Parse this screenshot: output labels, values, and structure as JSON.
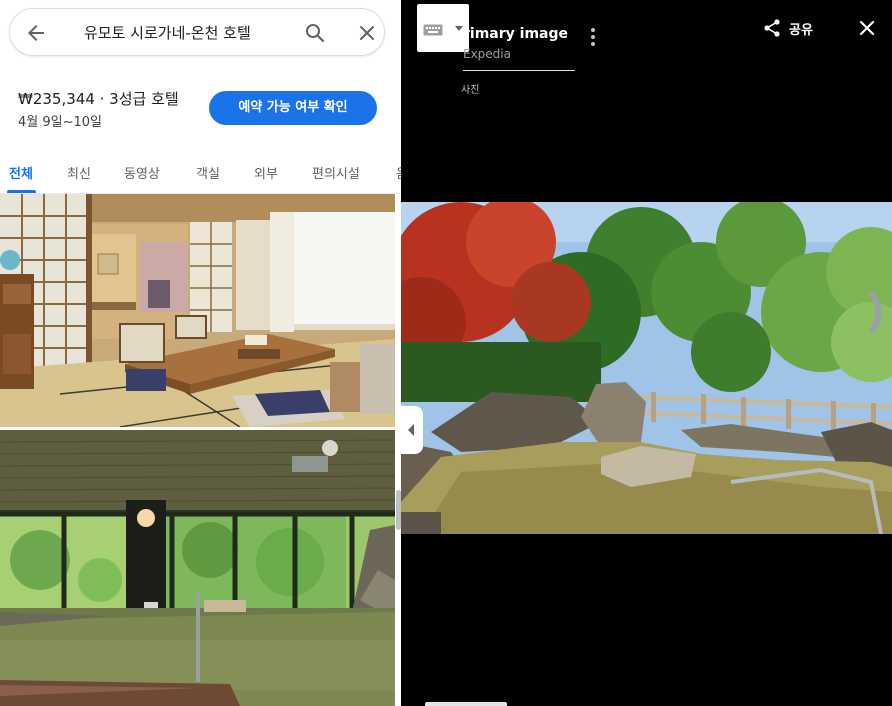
{
  "search": {
    "query": "유모토 시로가네-온천 호텔"
  },
  "hotel": {
    "price_line": "₩235,344 · 3성급 호텔",
    "dates": "4월 9일~10일",
    "cta_label": "예약 가능 여부 확인"
  },
  "tabs": [
    {
      "label": "전체",
      "active": true
    },
    {
      "label": "최신"
    },
    {
      "label": "동영상"
    },
    {
      "label": "객실"
    },
    {
      "label": "외부"
    },
    {
      "label": "편의시설"
    },
    {
      "label": "음"
    }
  ],
  "viewer": {
    "title": "rimary image",
    "source": "Expedia",
    "caption": "사진",
    "share_label": "공유"
  },
  "colors": {
    "accent": "#1a73e8",
    "viewer_bg": "#000000"
  },
  "icons": [
    "back-arrow-icon",
    "search-icon",
    "close-icon",
    "keyboard-icon",
    "dropdown-arrow-icon",
    "more-vert-icon",
    "share-icon",
    "collapse-arrow-icon"
  ]
}
